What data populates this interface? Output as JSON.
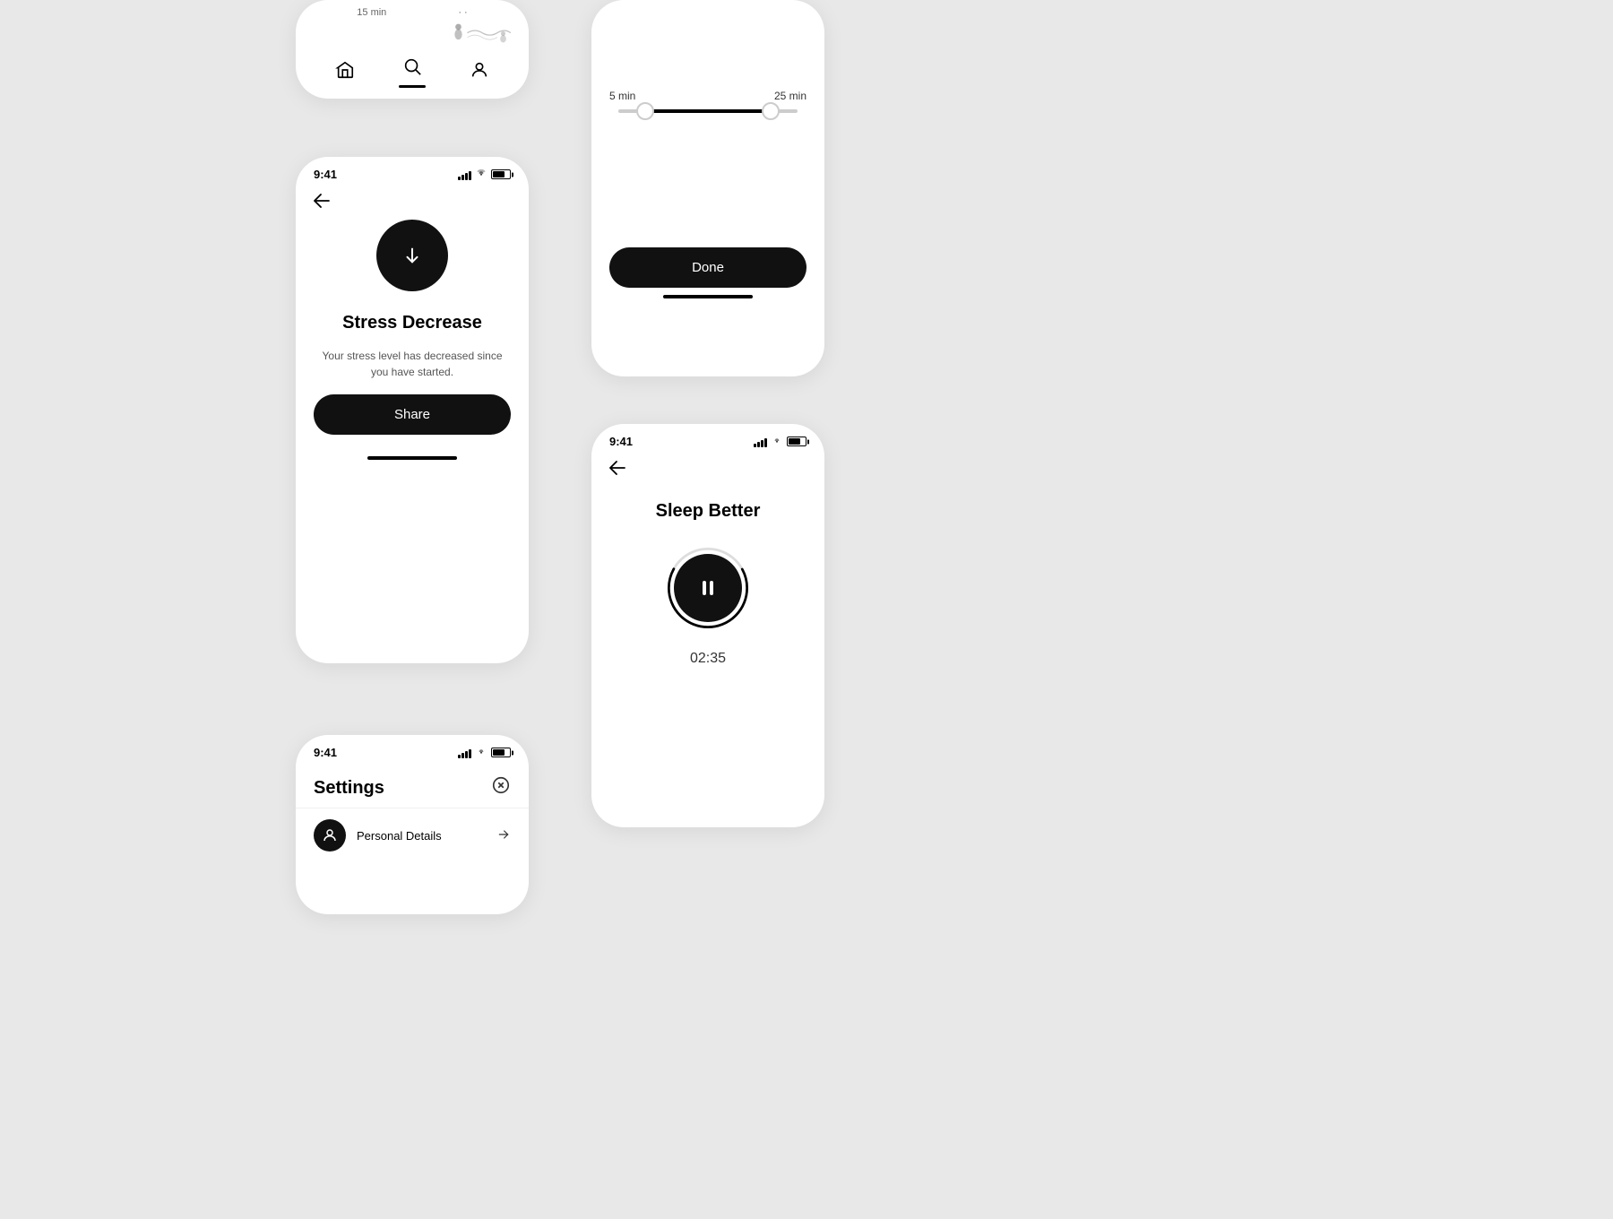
{
  "background": "#e8e8e8",
  "cards": {
    "top_partial": {
      "time": "15 min",
      "nav_items": [
        {
          "name": "home",
          "icon": "⌂",
          "active": false
        },
        {
          "name": "search",
          "icon": "⌕",
          "active": true
        },
        {
          "name": "profile",
          "icon": "⊙",
          "active": false
        }
      ]
    },
    "stress": {
      "status_time": "9:41",
      "title": "Stress Decrease",
      "description": "Your stress level has decreased since you have started.",
      "share_label": "Share",
      "arrow_icon": "↓"
    },
    "settings": {
      "status_time": "9:41",
      "title": "Settings",
      "rows": [
        {
          "label": "Personal Details",
          "icon": "👤"
        }
      ]
    },
    "range": {
      "min_label": "5 min",
      "max_label": "25 min",
      "done_label": "Done"
    },
    "sleep": {
      "status_time": "9:41",
      "title": "Sleep Better",
      "timer": "02:35"
    }
  }
}
